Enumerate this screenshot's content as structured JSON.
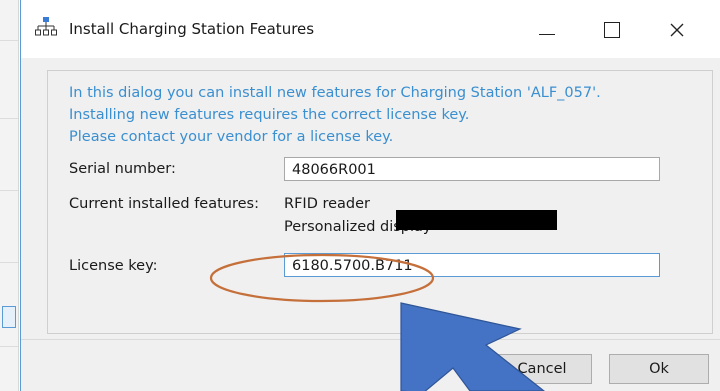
{
  "window": {
    "title": "Install Charging Station Features"
  },
  "dialog": {
    "info_lines": [
      "In this dialog you can install new features for Charging Station 'ALF_057'.",
      "Installing new features requires the correct license key.",
      "Please contact your vendor for a license key."
    ],
    "serial_label": "Serial number:",
    "serial_value": "48066R001",
    "features_label": "Current installed features:",
    "features": [
      "RFID reader",
      "Personalized display"
    ],
    "license_label": "License key:",
    "license_value": "6180.5700.B711"
  },
  "buttons": {
    "cancel": "Cancel",
    "ok": "Ok"
  },
  "colors": {
    "info_text": "#3a8fd0",
    "annotation_arrow": "#4472c4",
    "annotation_ellipse": "#c5703a"
  }
}
